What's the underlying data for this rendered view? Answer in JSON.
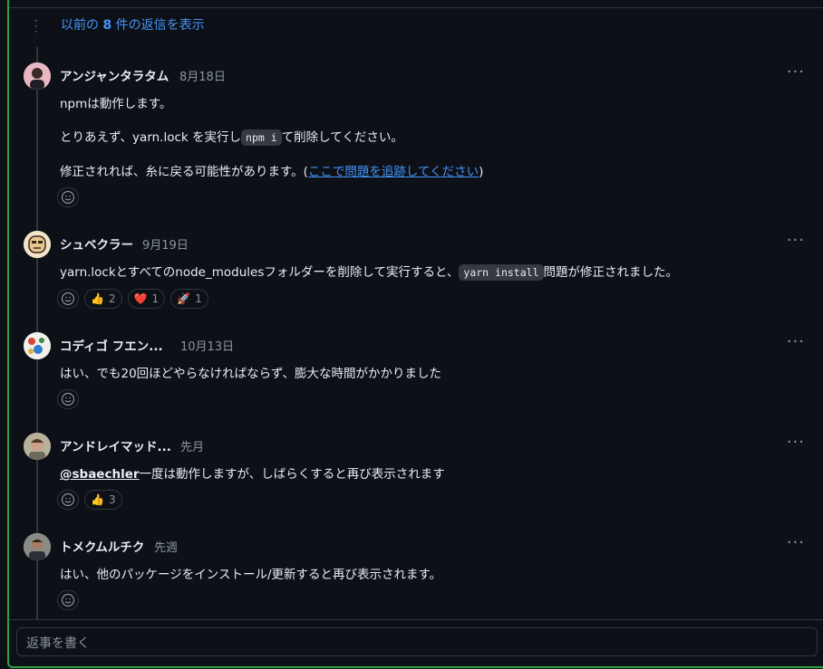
{
  "thread": {
    "show_more": {
      "prefix": "以前の ",
      "count": "8",
      "suffix": " 件の返信を表示"
    }
  },
  "comments": [
    {
      "author": "アンジャンタラタム",
      "time": "8月18日",
      "lines": [
        {
          "text": "npmは動作します。"
        },
        {
          "before": "とりあえず、yarn.lock を実行し",
          "code": "npm i",
          "after": "て削除してください。"
        },
        {
          "before": "修正されれば、糸に戻る可能性があります。(",
          "link": "ここで問題を追跡してください",
          "after": ")"
        }
      ],
      "reactions": []
    },
    {
      "author": "シュベクラー",
      "time": "9月19日",
      "lines": [
        {
          "before": "yarn.lockとすべてのnode_modulesフォルダーを削除して実行すると、",
          "code": "yarn install",
          "after": "問題が修正されました。"
        }
      ],
      "reactions": [
        {
          "icon": "thumbs-up",
          "emoji": "👍",
          "count": "2"
        },
        {
          "icon": "heart",
          "emoji": "❤️",
          "count": "1"
        },
        {
          "icon": "rocket",
          "emoji": "🚀",
          "count": "1"
        }
      ]
    },
    {
      "author": "コディゴ フエン...",
      "time": "10月13日",
      "lines": [
        {
          "text": "はい、でも20回ほどやらなければならず、膨大な時間がかかりました"
        }
      ],
      "reactions": []
    },
    {
      "author": "アンドレイマッド...",
      "time": "先月",
      "lines": [
        {
          "mention": "@sbaechler",
          "after": "一度は動作しますが、しばらくすると再び表示されます"
        }
      ],
      "reactions": [
        {
          "icon": "thumbs-up",
          "emoji": "👍",
          "count": "3"
        }
      ]
    },
    {
      "author": "トメクムルチク",
      "time": "先週",
      "lines": [
        {
          "text": "はい、他のパッケージをインストール/更新すると再び表示されます。"
        }
      ],
      "reactions": []
    }
  ],
  "reply": {
    "placeholder": "返事を書く"
  },
  "colors": {
    "accent_link": "#4493f8",
    "border_green": "#2ea043",
    "background": "#0d1117"
  }
}
